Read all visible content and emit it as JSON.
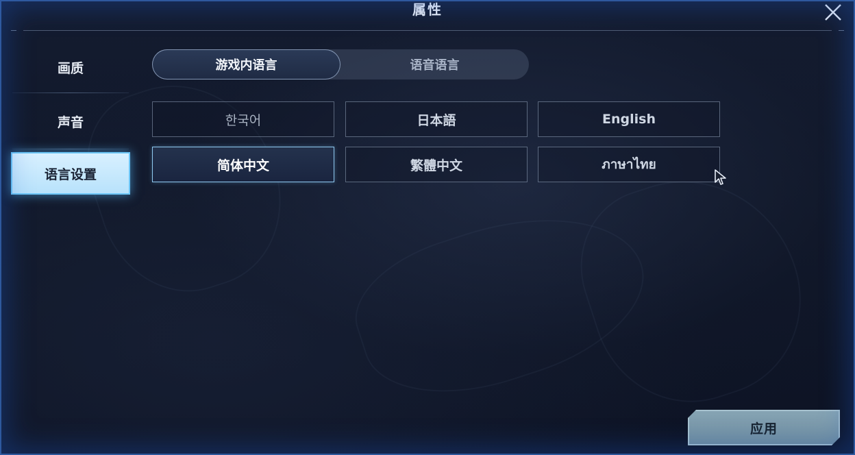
{
  "window": {
    "title": "属性",
    "close_icon": "close-icon"
  },
  "sidebar": {
    "items": [
      {
        "label": "画质"
      },
      {
        "label": "声音"
      },
      {
        "label": "语言设置",
        "active": true
      }
    ]
  },
  "tabs": [
    {
      "label": "游戏内语言",
      "active": true
    },
    {
      "label": "语音语言",
      "active": false
    }
  ],
  "languages": [
    {
      "label": "한국어",
      "selected": false
    },
    {
      "label": "日本語",
      "selected": false
    },
    {
      "label": "English",
      "selected": false
    },
    {
      "label": "简体中文",
      "selected": true
    },
    {
      "label": "繁體中文",
      "selected": false
    },
    {
      "label": "ภาษาไทย",
      "selected": false
    }
  ],
  "footer": {
    "apply_label": "应用"
  },
  "colors": {
    "active_tab_bg": "#d8f0ff",
    "border_glow": "#4682dc",
    "apply_bg": "#7a98aa"
  }
}
